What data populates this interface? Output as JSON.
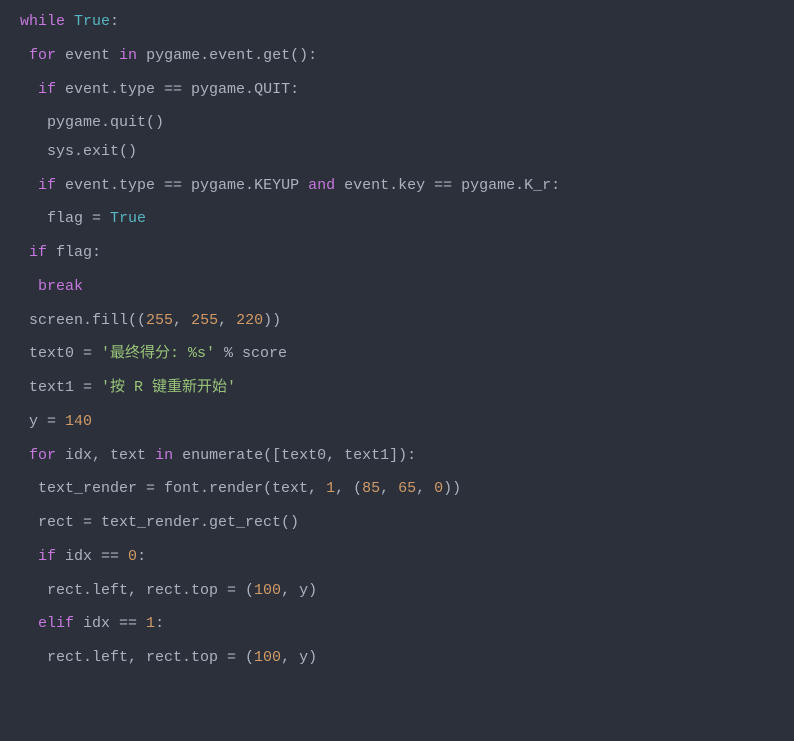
{
  "code": {
    "tokens": [
      [
        {
          "c": "kw",
          "t": "while"
        },
        {
          "c": "p",
          "t": " "
        },
        {
          "c": "bool",
          "t": "True"
        },
        {
          "c": "p",
          "t": ":"
        }
      ],
      [],
      [
        {
          "c": "p",
          "t": " "
        },
        {
          "c": "kw",
          "t": "for"
        },
        {
          "c": "p",
          "t": " event "
        },
        {
          "c": "op",
          "t": "in"
        },
        {
          "c": "p",
          "t": " pygame.event.get():"
        }
      ],
      [],
      [
        {
          "c": "p",
          "t": "  "
        },
        {
          "c": "kw",
          "t": "if"
        },
        {
          "c": "p",
          "t": " event.type == pygame.QUIT:"
        }
      ],
      [],
      [
        {
          "c": "p",
          "t": "   pygame.quit()"
        }
      ],
      [
        {
          "c": "p",
          "t": "   sys.exit()"
        }
      ],
      [],
      [
        {
          "c": "p",
          "t": "  "
        },
        {
          "c": "kw",
          "t": "if"
        },
        {
          "c": "p",
          "t": " event.type == pygame.KEYUP "
        },
        {
          "c": "op",
          "t": "and"
        },
        {
          "c": "p",
          "t": " event.key == pygame.K_r:"
        }
      ],
      [],
      [
        {
          "c": "p",
          "t": "   flag = "
        },
        {
          "c": "bool",
          "t": "True"
        }
      ],
      [],
      [
        {
          "c": "p",
          "t": " "
        },
        {
          "c": "kw",
          "t": "if"
        },
        {
          "c": "p",
          "t": " flag:"
        }
      ],
      [],
      [
        {
          "c": "p",
          "t": "  "
        },
        {
          "c": "kw",
          "t": "break"
        }
      ],
      [],
      [
        {
          "c": "p",
          "t": " screen.fill(("
        },
        {
          "c": "num",
          "t": "255"
        },
        {
          "c": "p",
          "t": ", "
        },
        {
          "c": "num",
          "t": "255"
        },
        {
          "c": "p",
          "t": ", "
        },
        {
          "c": "num",
          "t": "220"
        },
        {
          "c": "p",
          "t": "))"
        }
      ],
      [],
      [
        {
          "c": "p",
          "t": " text0 = "
        },
        {
          "c": "str",
          "t": "'最终得分: %s'"
        },
        {
          "c": "p",
          "t": " % score"
        }
      ],
      [],
      [
        {
          "c": "p",
          "t": " text1 = "
        },
        {
          "c": "str",
          "t": "'按 R 键重新开始'"
        }
      ],
      [],
      [
        {
          "c": "p",
          "t": " y = "
        },
        {
          "c": "num",
          "t": "140"
        }
      ],
      [],
      [
        {
          "c": "p",
          "t": " "
        },
        {
          "c": "kw",
          "t": "for"
        },
        {
          "c": "p",
          "t": " idx, text "
        },
        {
          "c": "op",
          "t": "in"
        },
        {
          "c": "p",
          "t": " enumerate([text0, text1]):"
        }
      ],
      [],
      [
        {
          "c": "p",
          "t": "  text_render = font.render(text, "
        },
        {
          "c": "num",
          "t": "1"
        },
        {
          "c": "p",
          "t": ", ("
        },
        {
          "c": "num",
          "t": "85"
        },
        {
          "c": "p",
          "t": ", "
        },
        {
          "c": "num",
          "t": "65"
        },
        {
          "c": "p",
          "t": ", "
        },
        {
          "c": "num",
          "t": "0"
        },
        {
          "c": "p",
          "t": "))"
        }
      ],
      [],
      [
        {
          "c": "p",
          "t": "  rect = text_render.get_rect()"
        }
      ],
      [],
      [
        {
          "c": "p",
          "t": "  "
        },
        {
          "c": "kw",
          "t": "if"
        },
        {
          "c": "p",
          "t": " idx == "
        },
        {
          "c": "num",
          "t": "0"
        },
        {
          "c": "p",
          "t": ":"
        }
      ],
      [],
      [
        {
          "c": "p",
          "t": "   rect.left, rect.top = ("
        },
        {
          "c": "num",
          "t": "100"
        },
        {
          "c": "p",
          "t": ", y)"
        }
      ],
      [],
      [
        {
          "c": "p",
          "t": "  "
        },
        {
          "c": "kw",
          "t": "elif"
        },
        {
          "c": "p",
          "t": " idx == "
        },
        {
          "c": "num",
          "t": "1"
        },
        {
          "c": "p",
          "t": ":"
        }
      ],
      [],
      [
        {
          "c": "p",
          "t": "   rect.left, rect.top = ("
        },
        {
          "c": "num",
          "t": "100"
        },
        {
          "c": "p",
          "t": ", y)"
        }
      ]
    ]
  }
}
